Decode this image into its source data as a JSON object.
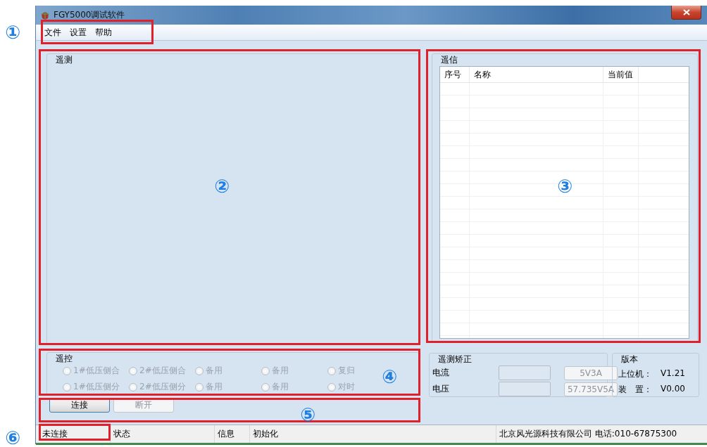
{
  "window": {
    "title": "FGY5000调试软件"
  },
  "menu": [
    {
      "label": "文件"
    },
    {
      "label": "设置"
    },
    {
      "label": "帮助"
    }
  ],
  "telemetry_panel": {
    "title": "遥测"
  },
  "signal_panel": {
    "title": "遥信",
    "table": {
      "columns": [
        "序号",
        "名称",
        "当前值"
      ]
    }
  },
  "control_panel": {
    "title": "遥控",
    "options": [
      {
        "label": "1#低压侧合",
        "selected": false,
        "disabled": true
      },
      {
        "label": "2#低压侧合",
        "selected": false,
        "disabled": true
      },
      {
        "label": "备用",
        "selected": false,
        "disabled": true
      },
      {
        "label": "备用",
        "selected": false,
        "disabled": true
      },
      {
        "label": "复归",
        "selected": false,
        "disabled": true
      },
      {
        "label": "1#低压侧分",
        "selected": false,
        "disabled": true
      },
      {
        "label": "2#低压侧分",
        "selected": false,
        "disabled": true
      },
      {
        "label": "备用",
        "selected": false,
        "disabled": true
      },
      {
        "label": "备用",
        "selected": false,
        "disabled": true
      },
      {
        "label": "对时",
        "selected": false,
        "disabled": true
      }
    ]
  },
  "connection_buttons": [
    {
      "label": "连接",
      "disabled": false
    },
    {
      "label": "断开",
      "disabled": true
    }
  ],
  "calibration_panel": {
    "title": "遥测矫正",
    "rows": [
      {
        "label": "电流",
        "button": "5V3A",
        "disabled": true
      },
      {
        "label": "电压",
        "button": "57.735V5A",
        "disabled": true
      }
    ]
  },
  "version_panel": {
    "title": "版本",
    "rows": [
      {
        "label": "上位机：",
        "value": "V1.21"
      },
      {
        "label": "装　置：",
        "value": "V0.00"
      }
    ]
  },
  "status_bar": [
    {
      "text": "未连接"
    },
    {
      "text": "状态"
    },
    {
      "text": "信息"
    },
    {
      "text": "初始化"
    },
    {
      "text": "北京风光源科技有限公司 电话:010-67875300"
    }
  ],
  "annotations": [
    {
      "label": "①"
    },
    {
      "label": "②"
    },
    {
      "label": "③"
    },
    {
      "label": "④"
    },
    {
      "label": "⑤"
    },
    {
      "label": "⑥"
    }
  ]
}
